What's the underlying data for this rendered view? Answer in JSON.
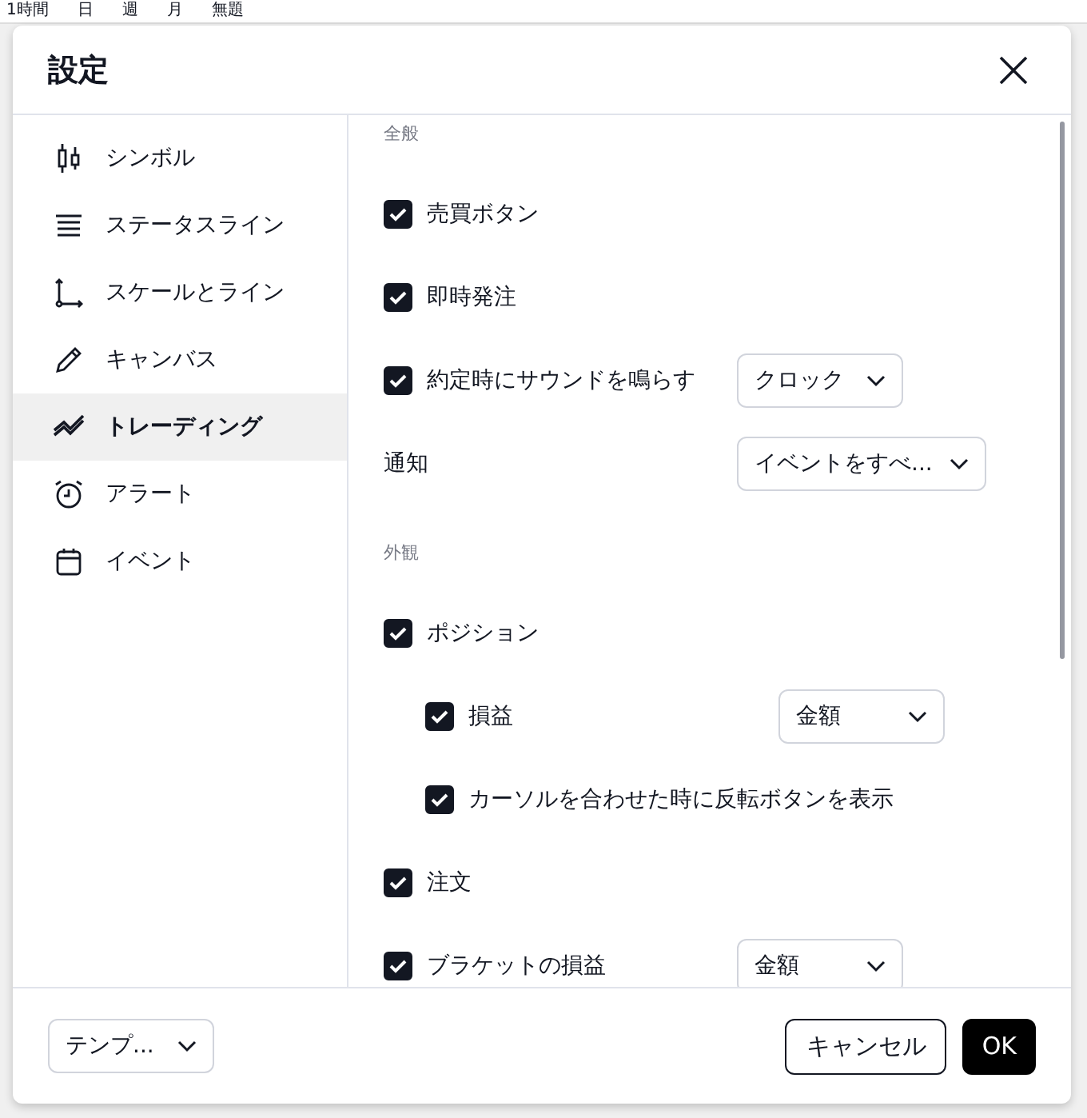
{
  "backdrop": {
    "toolbar": [
      "1時間",
      "日",
      "週",
      "月",
      "無題"
    ]
  },
  "dialog": {
    "title": "設定",
    "sidebar": {
      "items": [
        {
          "label": "シンボル",
          "selected": false
        },
        {
          "label": "ステータスライン",
          "selected": false
        },
        {
          "label": "スケールとライン",
          "selected": false
        },
        {
          "label": "キャンバス",
          "selected": false
        },
        {
          "label": "トレーディング",
          "selected": true
        },
        {
          "label": "アラート",
          "selected": false
        },
        {
          "label": "イベント",
          "selected": false
        }
      ]
    },
    "sections": [
      {
        "title": "全般",
        "rows": [
          {
            "kind": "checkbox",
            "label": "売買ボタン",
            "checked": true
          },
          {
            "kind": "checkbox",
            "label": "即時発注",
            "checked": true
          },
          {
            "kind": "checkbox",
            "label": "約定時にサウンドを鳴らす",
            "checked": true,
            "select": "クロック"
          },
          {
            "kind": "select",
            "label": "通知",
            "select": "イベントをすべ..."
          }
        ]
      },
      {
        "title": "外観",
        "rows": [
          {
            "kind": "checkbox",
            "label": "ポジション",
            "checked": true,
            "children": [
              {
                "kind": "checkbox",
                "label": "損益",
                "checked": true,
                "select": "金額"
              },
              {
                "kind": "checkbox",
                "label": "カーソルを合わせた時に反転ボタンを表示",
                "checked": true
              }
            ]
          },
          {
            "kind": "checkbox",
            "label": "注文",
            "checked": true
          },
          {
            "kind": "checkbox",
            "label": "ブラケットの損益",
            "checked": true,
            "select": "金額"
          }
        ]
      }
    ],
    "footer": {
      "template": "テンプ...",
      "cancel": "キャンセル",
      "ok": "OK"
    }
  }
}
